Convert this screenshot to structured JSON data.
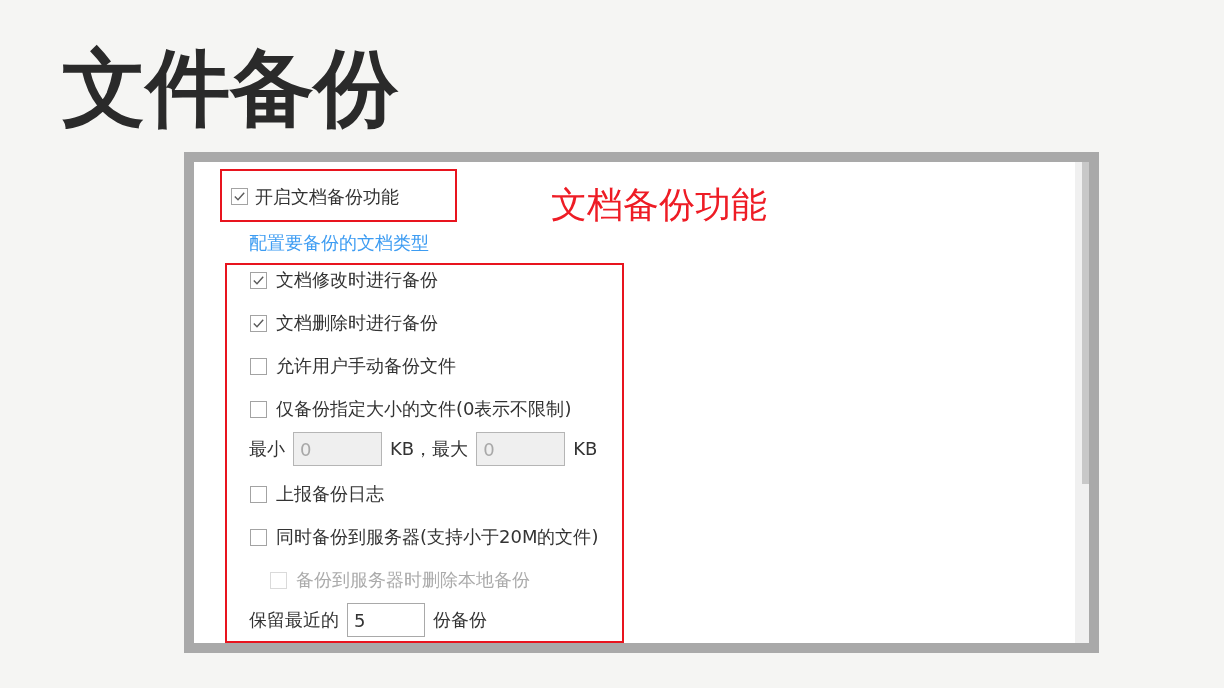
{
  "title": "文件备份",
  "screenshot": {
    "master_option": {
      "label": "开启文档备份功能",
      "checked": true
    },
    "annotation": "文档备份功能",
    "link": "配置要备份的文档类型",
    "options": [
      {
        "kind": "checkbox",
        "label": "文档修改时进行备份",
        "checked": true,
        "disabled": false
      },
      {
        "kind": "checkbox",
        "label": "文档删除时进行备份",
        "checked": true,
        "disabled": false
      },
      {
        "kind": "checkbox",
        "label": "允许用户手动备份文件",
        "checked": false,
        "disabled": false
      },
      {
        "kind": "checkbox",
        "label": "仅备份指定大小的文件(0表示不限制)",
        "checked": false,
        "disabled": false
      },
      {
        "kind": "size_range",
        "min_label": "最小",
        "min_value": "0",
        "max_label": "KB，最大",
        "max_value": "0",
        "unit": "KB",
        "disabled": true
      },
      {
        "kind": "checkbox",
        "label": "上报备份日志",
        "checked": false,
        "disabled": false
      },
      {
        "kind": "checkbox",
        "label": "同时备份到服务器(支持小于20M的文件)",
        "checked": false,
        "disabled": false,
        "children": [
          {
            "kind": "checkbox",
            "label": "备份到服务器时删除本地备份",
            "checked": false,
            "disabled": true
          }
        ]
      },
      {
        "kind": "keep_count",
        "prefix": "保留最近的",
        "value": "5",
        "suffix": "份备份",
        "disabled": false
      }
    ]
  }
}
